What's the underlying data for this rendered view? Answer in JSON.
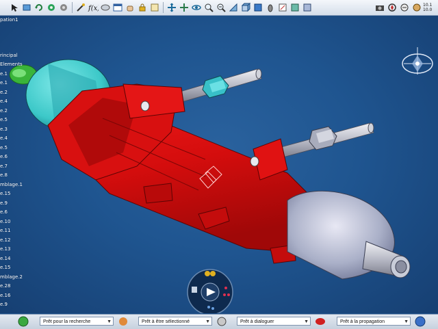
{
  "toolbar": {
    "icons": [
      "arrow-icon",
      "mirror-icon",
      "rotate-icon",
      "recycle-icon",
      "settings-icon",
      "wand-icon",
      "fx-icon",
      "chat-icon",
      "table-icon",
      "hand-icon",
      "lock-icon",
      "scroll-icon",
      "fit-all-icon",
      "pan-icon",
      "rotate-view-icon",
      "zoom-in-icon",
      "zoom-out-icon",
      "normal-view-icon",
      "iso-view-icon",
      "cube-view-icon",
      "render-style-icon",
      "hide-show-icon",
      "swap-space-icon",
      "material-icon",
      "camera-icon",
      "compass-icon",
      "measure-icon",
      "analysis-icon"
    ],
    "value_top": "10.1",
    "value_bottom": "10.0"
  },
  "tree": {
    "items": [
      "pation1",
      "",
      "rincipal",
      "Elements",
      "e.1",
      "e.1",
      "e.2",
      "e.4",
      "e.2",
      "e.5",
      "e.3",
      "e.4",
      "e.5",
      "e.6",
      "e.7",
      "e.8",
      "mblage.1",
      "e.15",
      "e.9",
      "e.6",
      "e.10",
      "e.11",
      "e.12",
      "e.13",
      "e.14",
      "e.15",
      "mblage.2",
      "e.28",
      "e.16",
      "e.9"
    ]
  },
  "compass": {
    "icon": "compass-icon"
  },
  "wheel": {
    "center_icon": "play-icon",
    "icons": [
      "users-icon",
      "hierarchy-icon",
      "doc-icon",
      "network-icon"
    ]
  },
  "statusbar": {
    "fields": [
      {
        "label": "Prêt pour la recherche",
        "icon": "search-green-icon"
      },
      {
        "label": "Prêt à être sélectionné",
        "icon": "select-icon"
      },
      {
        "label": "Prêt à dialoguer",
        "icon": "dialog-icon"
      },
      {
        "label": "Prêt à la propagation",
        "icon": "propagation-icon"
      }
    ],
    "end_icon": "globe-icon"
  }
}
